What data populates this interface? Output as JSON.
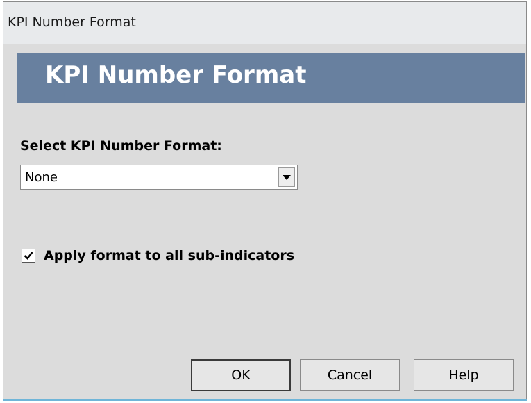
{
  "window": {
    "title": "KPI Number Format"
  },
  "banner": {
    "heading": "KPI Number Format"
  },
  "format_select": {
    "label": "Select KPI Number Format:",
    "value": "None"
  },
  "apply_subindicators": {
    "label": "Apply format to all sub-indicators",
    "checked": true
  },
  "buttons": {
    "ok": "OK",
    "cancel": "Cancel",
    "help": "Help"
  },
  "colors": {
    "banner": "#68809f",
    "dialog_bg": "#dcdcdc",
    "accent": "#6fb5d8"
  }
}
